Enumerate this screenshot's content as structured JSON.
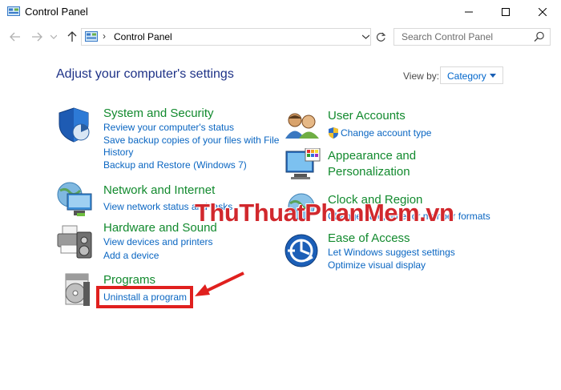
{
  "window": {
    "title": "Control Panel"
  },
  "address": {
    "crumb": "Control Panel",
    "separator": "›"
  },
  "search": {
    "placeholder": "Search Control Panel"
  },
  "header": {
    "heading": "Adjust your computer's settings",
    "view_by_label": "View by:",
    "view_by_value": "Category"
  },
  "categories": {
    "system_security": {
      "title": "System and Security",
      "links": [
        "Review your computer's status",
        "Save backup copies of your files with File",
        "History",
        "Backup and Restore (Windows 7)"
      ]
    },
    "network": {
      "title": "Network and Internet",
      "links": [
        "View network status and tasks"
      ]
    },
    "hardware": {
      "title": "Hardware and Sound",
      "links": [
        "View devices and printers",
        "Add a device"
      ]
    },
    "programs": {
      "title": "Programs",
      "links": [
        "Uninstall a program"
      ]
    },
    "user_accounts": {
      "title": "User Accounts",
      "links": [
        "Change account type"
      ]
    },
    "appearance": {
      "title_line1": "Appearance and",
      "title_line2": "Personalization"
    },
    "clock": {
      "title": "Clock and Region",
      "links": [
        "Change date, time, or number formats"
      ]
    },
    "ease": {
      "title": "Ease of Access",
      "links": [
        "Let Windows suggest settings",
        "Optimize visual display"
      ]
    }
  },
  "watermark": {
    "part1": "ThuThuat",
    "part2": "PhanMem",
    "part3": ".vn"
  },
  "colors": {
    "heading": "#1e3287",
    "category_title": "#128a2e",
    "link": "#0a66c2",
    "highlight": "#e0201e"
  }
}
